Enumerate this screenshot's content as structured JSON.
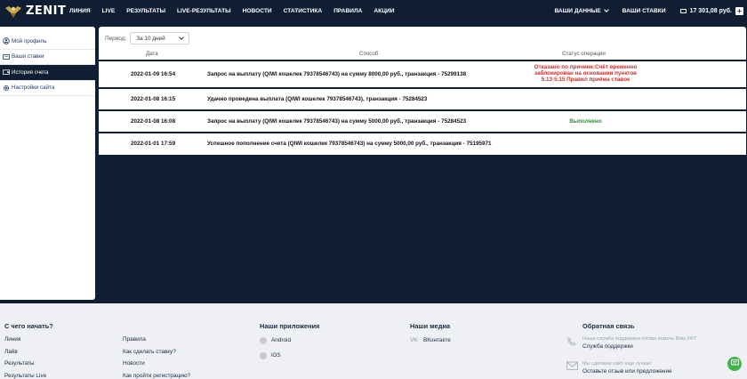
{
  "header": {
    "logo_text": "ZENIT",
    "nav": [
      "ЛИНИЯ",
      "LIVE",
      "РЕЗУЛЬТАТЫ",
      "LIVE-РЕЗУЛЬТАТЫ",
      "НОВОСТИ",
      "СТАТИСТИКА",
      "ПРАВИЛА",
      "АКЦИИ"
    ],
    "your_data": "ВАШИ ДАННЫЕ",
    "your_bets": "ВАШИ СТАВКИ",
    "balance": "17 301,08 руб.",
    "add_funds": "+"
  },
  "sidebar": {
    "items": [
      {
        "label": "Мой профиль",
        "icon": "user-icon"
      },
      {
        "label": "Ваши ставки",
        "icon": "ticket-icon"
      },
      {
        "label": "История счета",
        "icon": "wallet-icon",
        "active": true
      },
      {
        "label": "Настройки сайта",
        "icon": "gear-icon"
      }
    ]
  },
  "history": {
    "period_label": "Период:",
    "period_value": "За 10 дней",
    "columns": {
      "date": "Дата",
      "method": "Способ",
      "status": "Статус операции"
    },
    "rows": [
      {
        "date": "2022-01-09 16:54",
        "method": "Запрос на выплату (QIWI кошелек 79378546743) на сумму 8000,00 руб., транзакция - 75299138",
        "status_lines": [
          "Отказано по причине:Счёт временно",
          "заблокирован на основании пунктов",
          "5.13-5.15 Правил приёма ставок"
        ],
        "status_color": "#c9302c"
      },
      {
        "date": "2022-01-08 16:15",
        "method": "Удачно проведена выплата (QIWI кошелек 79378546743), транзакция - 75284523",
        "status_lines": [],
        "status_color": ""
      },
      {
        "date": "2022-01-08 16:08",
        "method": "Запрос на выплату (QIWI кошелек 79378546743) на сумму 5000,00 руб., транзакция - 75284523",
        "status_lines": [
          "Выполнено"
        ],
        "status_color": "#2e8b2e"
      },
      {
        "date": "2022-01-01 17:59",
        "method": "Успешное пополнение счета (QIWI кошелек 79378546743) на сумму 5000,00 руб., транзакция - 75195971",
        "status_lines": [],
        "status_color": ""
      }
    ]
  },
  "footer": {
    "start": {
      "title": "С чего начать?",
      "links_a": [
        "Линия",
        "Лайв",
        "Результаты",
        "Результаты Live"
      ],
      "links_b": [
        "Правила",
        "Как сделать ставку?",
        "Новости",
        "Как пройти регистрацию?"
      ]
    },
    "apps": {
      "title": "Наши приложения",
      "items": [
        "Android",
        "iOS"
      ]
    },
    "media": {
      "title": "Наши медиа",
      "items": [
        "ВКонтакте"
      ],
      "icon_text": "VK"
    },
    "feedback": {
      "title": "Обратная связь",
      "support_muted": "Наша служба поддержки готова помочь Вам 24/7",
      "support_link": "Служба поддержки",
      "review_muted": "Мы сделаем сайт еще лучше!",
      "review_link": "Оставьте отзыв или предложение"
    }
  }
}
